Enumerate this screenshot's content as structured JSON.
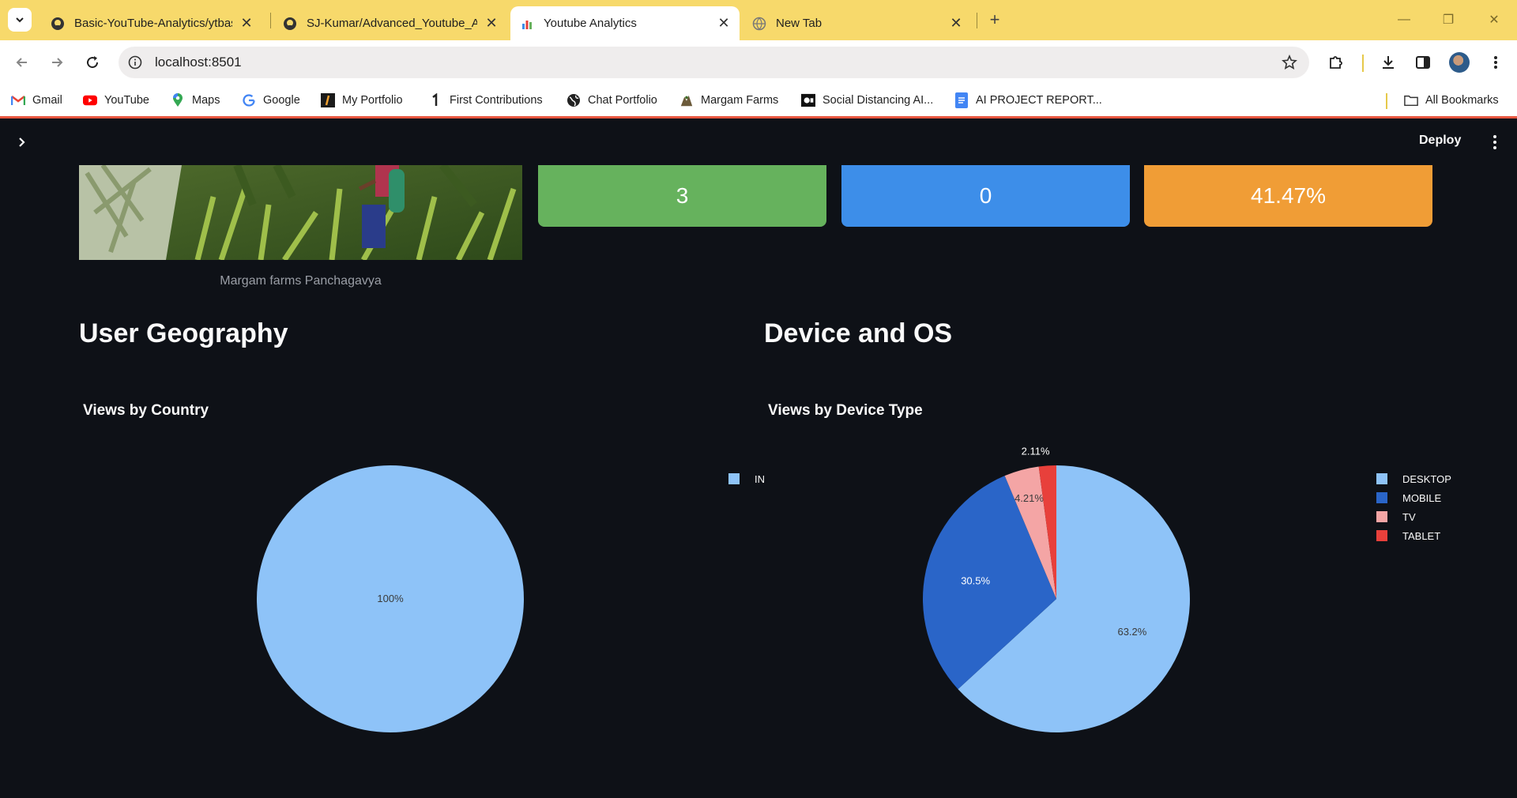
{
  "browser": {
    "tabs": [
      {
        "title": "Basic-YouTube-Analytics/ytbasic",
        "icon": "github-icon",
        "active": false
      },
      {
        "title": "SJ-Kumar/Advanced_Youtube_A",
        "icon": "github-icon",
        "active": false
      },
      {
        "title": "Youtube Analytics",
        "icon": "chart-favicon-icon",
        "active": true
      },
      {
        "title": "New Tab",
        "icon": "globe-icon",
        "active": false
      }
    ],
    "url": "localhost:8501",
    "bookmarks": [
      {
        "label": "Gmail",
        "icon": "gmail-icon"
      },
      {
        "label": "YouTube",
        "icon": "youtube-icon"
      },
      {
        "label": "Maps",
        "icon": "maps-pin-icon"
      },
      {
        "label": "Google",
        "icon": "google-icon"
      },
      {
        "label": "My Portfolio",
        "icon": "portfolio-icon"
      },
      {
        "label": "First Contributions",
        "icon": "first-contributions-icon"
      },
      {
        "label": "Chat Portfolio",
        "icon": "globe-icon"
      },
      {
        "label": "Margam Farms",
        "icon": "farm-icon"
      },
      {
        "label": "Social Distancing AI...",
        "icon": "camera-icon"
      },
      {
        "label": "AI PROJECT REPORT...",
        "icon": "docs-icon"
      }
    ],
    "all_bookmarks_label": "All Bookmarks",
    "accent_color": "#f7d96b"
  },
  "app": {
    "deploy_label": "Deploy",
    "image_caption": "Margam farms Panchagavya",
    "metrics": [
      {
        "value": "3",
        "color": "#66b25d"
      },
      {
        "value": "0",
        "color": "#3d8ee9"
      },
      {
        "value": "41.47%",
        "color": "#f09d36"
      }
    ],
    "sections": {
      "geography_title": "User Geography",
      "device_title": "Device and OS"
    },
    "background_color": "#0e1117"
  },
  "chart_data": [
    {
      "type": "pie",
      "title": "Views by Country",
      "labels": [
        "IN"
      ],
      "values": [
        100
      ],
      "text_labels": [
        "100%"
      ],
      "colors": [
        "#8ec3f8"
      ],
      "legend_position": "top-right"
    },
    {
      "type": "pie",
      "title": "Views by Device Type",
      "labels": [
        "DESKTOP",
        "MOBILE",
        "TV",
        "TABLET"
      ],
      "values": [
        63.2,
        30.5,
        4.21,
        2.11
      ],
      "text_labels": [
        "63.2%",
        "30.5%",
        "4.21%",
        "2.11%"
      ],
      "colors": [
        "#8ec3f8",
        "#2a65c8",
        "#f4a5a5",
        "#e8403b"
      ],
      "legend_position": "top-right"
    }
  ]
}
